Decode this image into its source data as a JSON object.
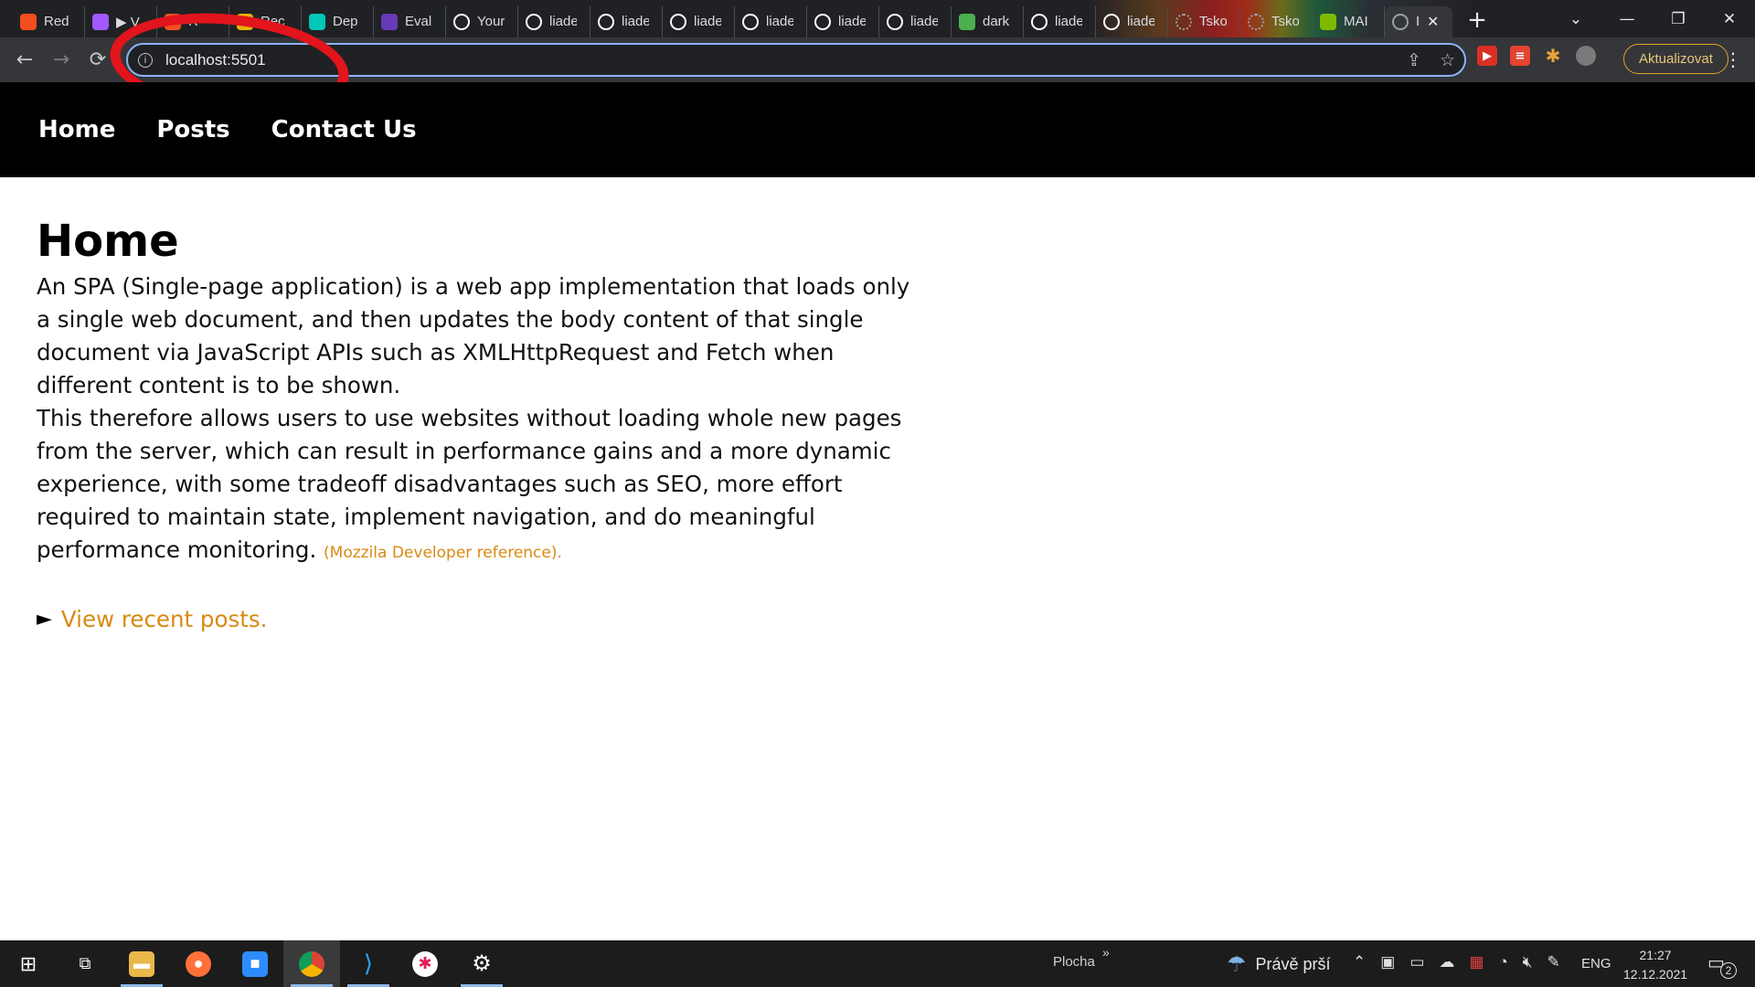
{
  "browser": {
    "tabs": [
      {
        "title": "Red",
        "icon": "figma-icon",
        "color": "#f24e1e"
      },
      {
        "title": "▶ V",
        "icon": "figma-icon",
        "color": "#a259ff"
      },
      {
        "title": "R",
        "icon": "app-icon",
        "color": "#f25022"
      },
      {
        "title": "Rec",
        "icon": "recording-icon",
        "color": "#e8b400"
      },
      {
        "title": "Dep",
        "icon": "deploy-icon",
        "color": "#00c7b7"
      },
      {
        "title": "Eval",
        "icon": "form-icon",
        "color": "#673ab7"
      },
      {
        "title": "Your",
        "icon": "github-icon",
        "color": "#ffffff"
      },
      {
        "title": "liade",
        "icon": "github-icon",
        "color": "#ffffff"
      },
      {
        "title": "liade",
        "icon": "github-icon",
        "color": "#ffffff"
      },
      {
        "title": "liade",
        "icon": "github-icon",
        "color": "#ffffff"
      },
      {
        "title": "liade",
        "icon": "github-icon",
        "color": "#ffffff"
      },
      {
        "title": "liade",
        "icon": "github-icon",
        "color": "#ffffff"
      },
      {
        "title": "liade",
        "icon": "github-icon",
        "color": "#ffffff"
      },
      {
        "title": "dark",
        "icon": "chrome-store-icon",
        "color": "#4caf50"
      },
      {
        "title": "liade",
        "icon": "github-icon",
        "color": "#ffffff"
      },
      {
        "title": "liade",
        "icon": "github-icon",
        "color": "#ffffff"
      },
      {
        "title": "Tsko",
        "icon": "loading-icon",
        "color": "#9aa0a6"
      },
      {
        "title": "Tsko",
        "icon": "loading-icon",
        "color": "#9aa0a6"
      },
      {
        "title": "MAI",
        "icon": "microsoft-icon",
        "color": "#7fba00"
      }
    ],
    "active_tab": {
      "title": "I",
      "icon": "globe-icon"
    },
    "new_tab_label": "+",
    "url": "localhost:5501",
    "update_label": "Aktualizovat"
  },
  "site": {
    "nav": [
      {
        "label": "Home"
      },
      {
        "label": "Posts"
      },
      {
        "label": "Contact Us"
      }
    ],
    "heading": "Home",
    "paragraph_1": "An SPA (Single-page application) is a web app implementation that loads only a single web document, and then updates the body content of that single document via JavaScript APIs such as XMLHttpRequest and Fetch when different content is to be shown.",
    "paragraph_2": "This therefore allows users to use websites without loading whole new pages from the server, which can result in performance gains and a more dynamic experience, with some tradeoff disadvantages such as SEO, more effort required to maintain state, implement navigation, and do meaningful performance monitoring.",
    "reference_link": "(Mozzila Developer reference).",
    "recent_marker": "►",
    "recent_link": "View recent posts.",
    "accent_color": "#d88a12"
  },
  "taskbar": {
    "desktop_label": "Plocha",
    "desktop_arrow": "»",
    "weather": "Právě prší",
    "language": "ENG",
    "time": "21:27",
    "date": "12.12.2021",
    "notification_count": "2"
  }
}
